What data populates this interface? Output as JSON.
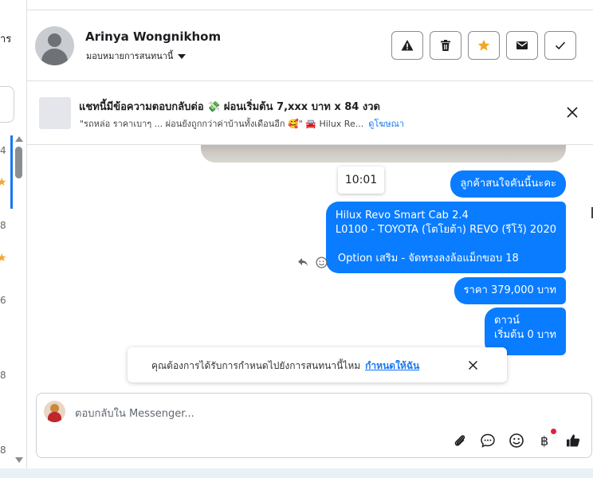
{
  "left_list": {
    "top_fragment": "าร",
    "row_numbers": [
      "4",
      "8",
      "6",
      "8",
      "8"
    ]
  },
  "header": {
    "contact_name": "Arinya Wongnikhom",
    "assign_label": "มอบหมายการสนทนานี้",
    "buttons": [
      "warning-button",
      "delete-button",
      "star-button",
      "mail-button",
      "done-button"
    ],
    "star_color": "#f5a623"
  },
  "ad_banner": {
    "title": "แชทนี้มีข้อความตอบกลับต่อ 💸 ผ่อนเริ่มต้น 7,xxx บาท x 84 งวด",
    "subtitle": "\"รถหล่อ ราคาเบาๆ ... ผ่อนยังถูกกว่าค่าบ้านทั้งเดือนอีก 🥰\" 🚘 Hilux Re...",
    "link_label": "ดูโฆษณา"
  },
  "messages": {
    "time_tooltip": "10:01",
    "bubble_1": "ลูกค้าสนใจคันนี้นะคะ",
    "bubble_2_line1": "Hilux Revo Smart Cab 2.4",
    "bubble_2_line2": "L0100 - TOYOTA (โตโยต้า) REVO (รีโว้) 2020",
    "bubble_2_line3": "Option เสริม - จัดทรงลงล้อแม็กขอบ 18",
    "bubble_3": "ราคา 379,000 บาท",
    "bubble_4_line1": "ดาวน์",
    "bubble_4_line2": "เริ่มต้น 0 บาท",
    "bubble_color": "#0a7cff"
  },
  "toast": {
    "text": "คุณต้องการได้รับการกำหนดไปยังการสนทนานี้ไหม",
    "link_label": "กำหนดให้ฉัน"
  },
  "composer": {
    "placeholder": "ตอบกลับใน Messenger...",
    "tools": [
      "attachment-icon",
      "message-template-icon",
      "emoji-icon",
      "baht-payment-icon",
      "thumbs-up-icon"
    ]
  }
}
